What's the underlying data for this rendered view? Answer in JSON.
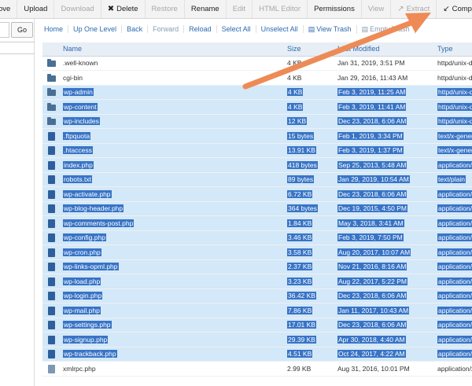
{
  "toolbar": {
    "items": [
      {
        "label": "ove",
        "disabled": false
      },
      {
        "label": "Upload",
        "disabled": false
      },
      {
        "label": "Download",
        "disabled": true
      },
      {
        "label": "Delete",
        "disabled": false,
        "icon": "✖"
      },
      {
        "label": "Restore",
        "disabled": true
      },
      {
        "label": "Rename",
        "disabled": false
      },
      {
        "label": "Edit",
        "disabled": true
      },
      {
        "label": "HTML Editor",
        "disabled": true
      },
      {
        "label": "Permissions",
        "disabled": false
      },
      {
        "label": "View",
        "disabled": true
      },
      {
        "label": "Extract",
        "disabled": true,
        "icon": "↗"
      },
      {
        "label": "Compress",
        "disabled": false,
        "icon": "↙"
      }
    ]
  },
  "left": {
    "go_label": "Go"
  },
  "navbar": {
    "items": [
      {
        "label": "Home",
        "disabled": false
      },
      {
        "label": "Up One Level",
        "disabled": false
      },
      {
        "label": "Back",
        "disabled": false
      },
      {
        "label": "Forward",
        "disabled": true
      },
      {
        "label": "Reload",
        "disabled": false
      },
      {
        "label": "Select All",
        "disabled": false
      },
      {
        "label": "Unselect All",
        "disabled": false
      },
      {
        "label": "View Trash",
        "disabled": false,
        "icon": "🗑"
      },
      {
        "label": "Empty Trash",
        "disabled": true,
        "icon": "🗑"
      }
    ]
  },
  "table": {
    "columns": {
      "name": "Name",
      "size": "Size",
      "date": "Last Modified",
      "type": "Type"
    },
    "rows": [
      {
        "kind": "folder",
        "name": ".well-known",
        "size": "4 KB",
        "date": "Jan 31, 2019, 3:51 PM",
        "type": "httpd/unix-directory",
        "selected": false
      },
      {
        "kind": "folder",
        "name": "cgi-bin",
        "size": "4 KB",
        "date": "Jan 29, 2016, 11:43 AM",
        "type": "httpd/unix-directory",
        "selected": false
      },
      {
        "kind": "folder",
        "name": "wp-admin",
        "size": "4 KB",
        "date": "Feb 3, 2019, 11:25 AM",
        "type": "httpd/unix-directory",
        "selected": true
      },
      {
        "kind": "folder",
        "name": "wp-content",
        "size": "4 KB",
        "date": "Feb 3, 2019, 11:41 AM",
        "type": "httpd/unix-directory",
        "selected": true
      },
      {
        "kind": "folder",
        "name": "wp-includes",
        "size": "12 KB",
        "date": "Dec 23, 2018, 6:06 AM",
        "type": "httpd/unix-directory",
        "selected": true
      },
      {
        "kind": "file",
        "name": ".ftpquota",
        "size": "15 bytes",
        "date": "Feb 1, 2019, 3:34 PM",
        "type": "text/x-generic",
        "selected": true
      },
      {
        "kind": "file",
        "name": ".htaccess",
        "size": "13.91 KB",
        "date": "Feb 3, 2019, 1:37 PM",
        "type": "text/x-generic",
        "selected": true
      },
      {
        "kind": "file",
        "name": "index.php",
        "size": "418 bytes",
        "date": "Sep 25, 2013, 5:48 AM",
        "type": "application/x-httpd-php",
        "selected": true
      },
      {
        "kind": "file",
        "name": "robots.txt",
        "size": "89 bytes",
        "date": "Jan 29, 2019, 10:54 AM",
        "type": "text/plain",
        "selected": true
      },
      {
        "kind": "file",
        "name": "wp-activate.php",
        "size": "6.72 KB",
        "date": "Dec 23, 2018, 6:06 AM",
        "type": "application/x-httpd-php",
        "selected": true
      },
      {
        "kind": "file",
        "name": "wp-blog-header.php",
        "size": "364 bytes",
        "date": "Dec 19, 2015, 4:50 PM",
        "type": "application/x-httpd-php",
        "selected": true
      },
      {
        "kind": "file",
        "name": "wp-comments-post.php",
        "size": "1.84 KB",
        "date": "May 3, 2018, 3:41 AM",
        "type": "application/x-httpd-php",
        "selected": true
      },
      {
        "kind": "file",
        "name": "wp-config.php",
        "size": "3.46 KB",
        "date": "Feb 3, 2019, 7:50 PM",
        "type": "application/x-httpd-php",
        "selected": true
      },
      {
        "kind": "file",
        "name": "wp-cron.php",
        "size": "3.58 KB",
        "date": "Aug 20, 2017, 10:07 AM",
        "type": "application/x-httpd-php",
        "selected": true
      },
      {
        "kind": "file",
        "name": "wp-links-opml.php",
        "size": "2.37 KB",
        "date": "Nov 21, 2016, 8:16 AM",
        "type": "application/x-httpd-php",
        "selected": true
      },
      {
        "kind": "file",
        "name": "wp-load.php",
        "size": "3.23 KB",
        "date": "Aug 22, 2017, 5:22 PM",
        "type": "application/x-httpd-php",
        "selected": true
      },
      {
        "kind": "file",
        "name": "wp-login.php",
        "size": "36.42 KB",
        "date": "Dec 23, 2018, 6:06 AM",
        "type": "application/x-httpd-php",
        "selected": true
      },
      {
        "kind": "file",
        "name": "wp-mail.php",
        "size": "7.86 KB",
        "date": "Jan 11, 2017, 10:43 AM",
        "type": "application/x-httpd-php",
        "selected": true
      },
      {
        "kind": "file",
        "name": "wp-settings.php",
        "size": "17.01 KB",
        "date": "Dec 23, 2018, 6:06 AM",
        "type": "application/x-httpd-php",
        "selected": true
      },
      {
        "kind": "file",
        "name": "wp-signup.php",
        "size": "29.39 KB",
        "date": "Apr 30, 2018, 4:40 AM",
        "type": "application/x-httpd-php",
        "selected": true
      },
      {
        "kind": "file",
        "name": "wp-trackback.php",
        "size": "4.51 KB",
        "date": "Oct 24, 2017, 4:22 AM",
        "type": "application/x-httpd-php",
        "selected": true
      },
      {
        "kind": "file",
        "name": "xmlrpc.php",
        "size": "2.99 KB",
        "date": "Aug 31, 2016, 10:01 PM",
        "type": "application/x-httpd-php",
        "selected": false
      }
    ]
  },
  "annotation": {
    "arrow_color": "#ee8a55",
    "arrow_target": "Compress"
  }
}
